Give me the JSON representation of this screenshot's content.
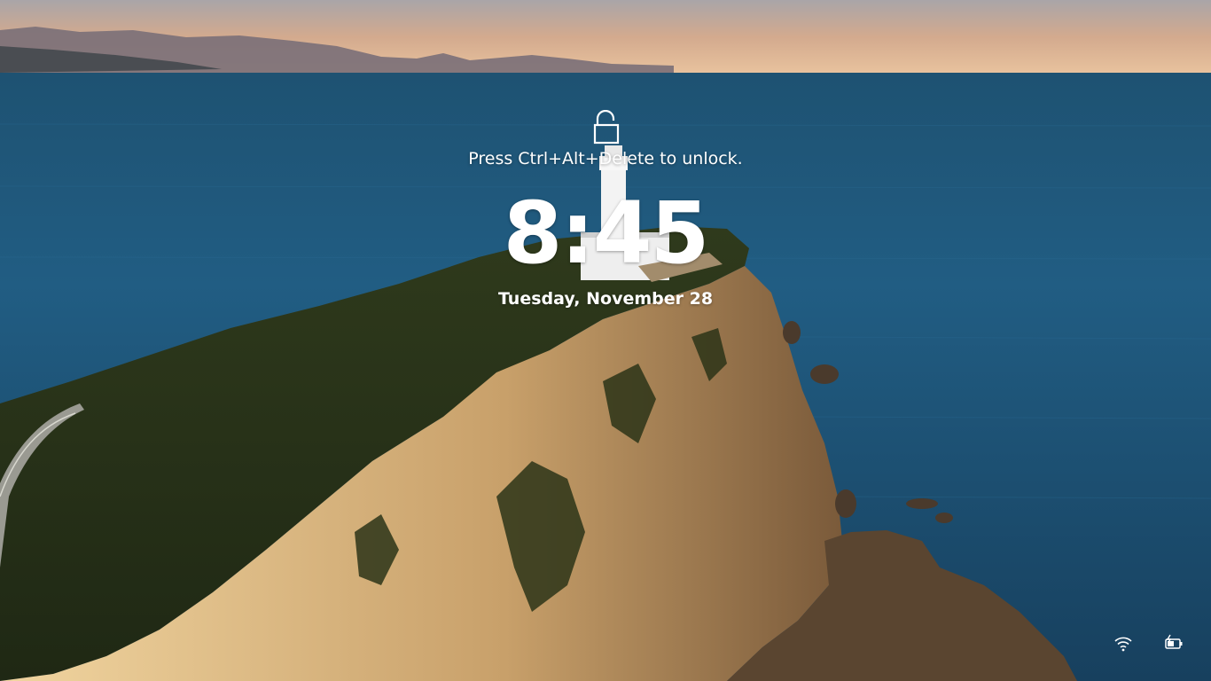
{
  "lockscreen": {
    "unlock_hint": "Press Ctrl+Alt+Delete to unlock.",
    "time": "8:45",
    "date": "Tuesday, November 28"
  },
  "icons": {
    "lock": "lock-open-icon",
    "wifi": "wifi-icon",
    "battery": "battery-charging-icon"
  },
  "colors": {
    "text": "#ffffff",
    "sea": "#1f5a7f",
    "sky": "#e8bd98"
  }
}
